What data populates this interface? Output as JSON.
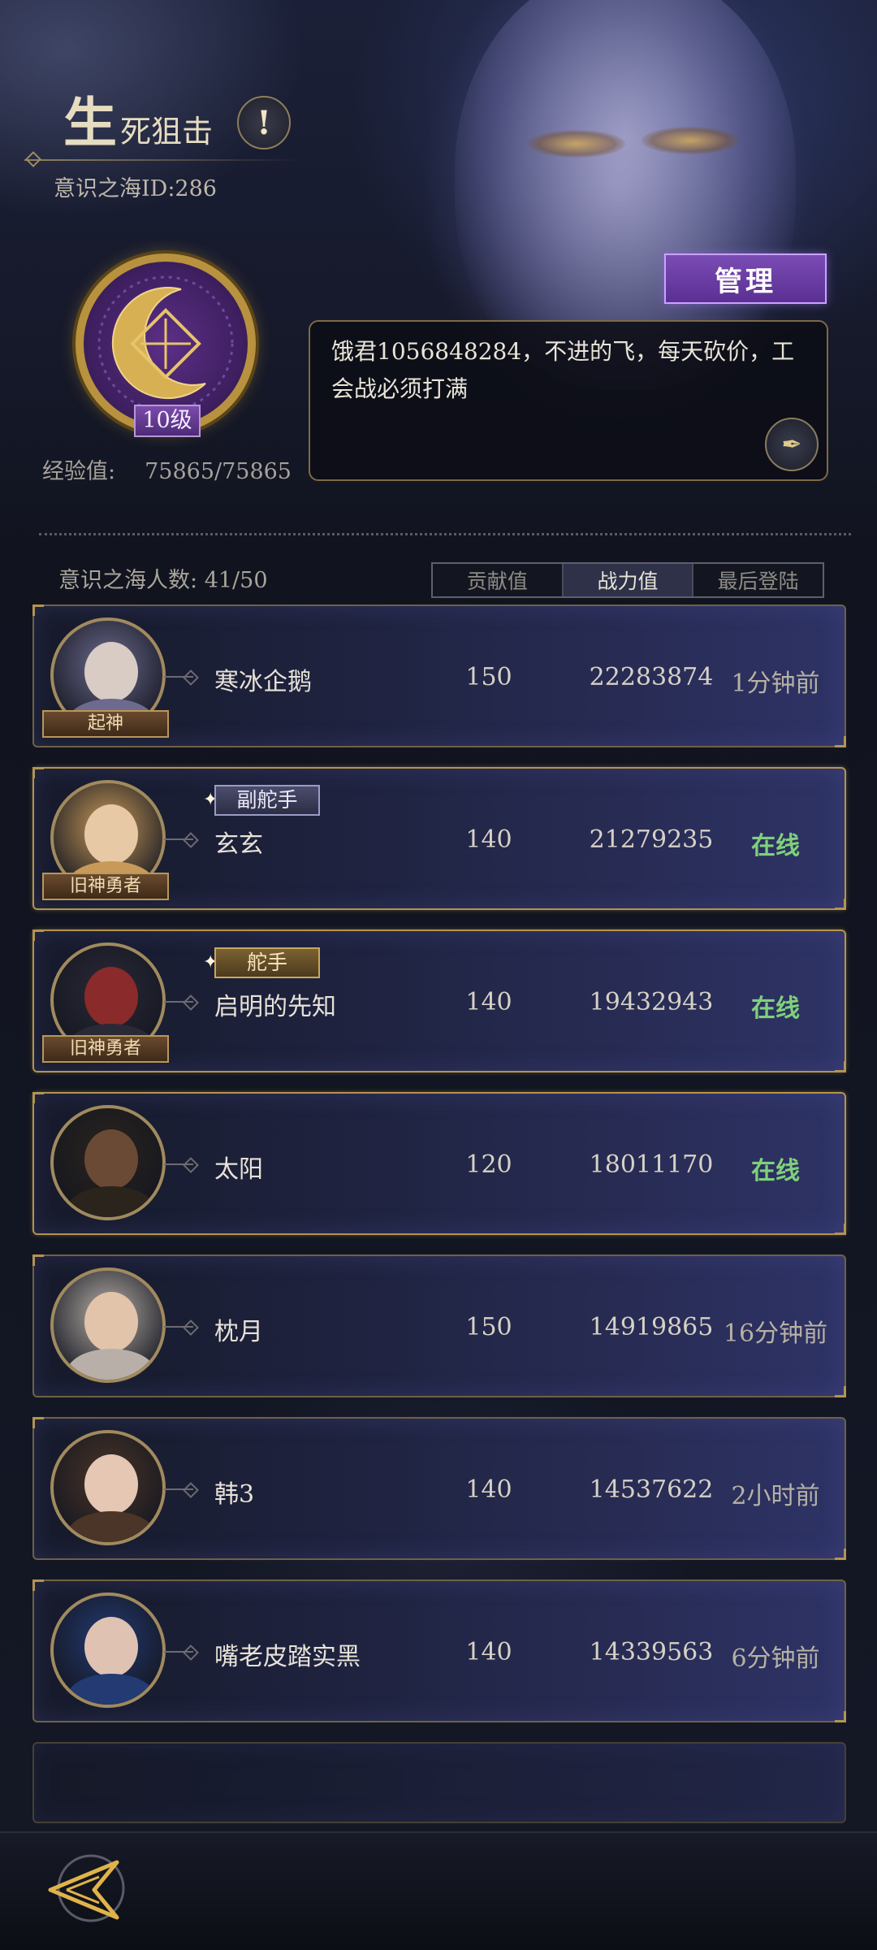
{
  "header": {
    "guild_name_big": "生",
    "guild_name_rest": "死狙击",
    "guild_id_label": "意识之海ID:",
    "guild_id": "286",
    "alert_glyph": "!"
  },
  "emblem": {
    "level": "10级",
    "exp_label": "经验值:",
    "exp_value": "75865/75865"
  },
  "manage_button": "管理",
  "notice": {
    "text": "饿君1056848284，不进的飞，每天砍价，工会战必须打满"
  },
  "members_header": {
    "count_label": "意识之海人数:",
    "count_value": "41/50",
    "tabs": [
      "贡献值",
      "战力值",
      "最后登陆"
    ],
    "active_tab": "战力值"
  },
  "members": [
    {
      "name": "寒冰企鹅",
      "contribution": "150",
      "power": "22283874",
      "last": "1分钟前",
      "online": false,
      "role": "",
      "title": "起神",
      "avatar_color": "#6d6a8e",
      "head_color": "#d8ccc4"
    },
    {
      "name": "玄玄",
      "contribution": "140",
      "power": "21279235",
      "last": "在线",
      "online": true,
      "role": "副舵手",
      "title": "旧神勇者",
      "avatar_color": "#c89a5a",
      "head_color": "#e8c9a6"
    },
    {
      "name": "启明的先知",
      "contribution": "140",
      "power": "19432943",
      "last": "在线",
      "online": true,
      "role": "舵手",
      "title": "旧神勇者",
      "avatar_color": "#2a2a36",
      "head_color": "#8a2a2a"
    },
    {
      "name": "太阳",
      "contribution": "120",
      "power": "18011170",
      "last": "在线",
      "online": true,
      "role": "",
      "title": "",
      "avatar_color": "#2a241c",
      "head_color": "#6a4a34"
    },
    {
      "name": "枕月",
      "contribution": "150",
      "power": "14919865",
      "last": "16分钟前",
      "online": false,
      "role": "",
      "title": "",
      "avatar_color": "#b8b0a8",
      "head_color": "#e2c4aa"
    },
    {
      "name": "韩3",
      "contribution": "140",
      "power": "14537622",
      "last": "2小时前",
      "online": false,
      "role": "",
      "title": "",
      "avatar_color": "#4a3528",
      "head_color": "#e6c7b4"
    },
    {
      "name": "嘴老皮踏实黑",
      "contribution": "140",
      "power": "14339563",
      "last": "6分钟前",
      "online": false,
      "role": "",
      "title": "",
      "avatar_color": "#233a72",
      "head_color": "#e0c2b2"
    }
  ],
  "icons": {
    "alert": "exclamation-icon",
    "edit": "quill-icon",
    "back": "back-arrow-icon"
  },
  "colors": {
    "online": "#7fd07c",
    "manage": "#6a3ea4",
    "gold_border": "#b4944c"
  }
}
